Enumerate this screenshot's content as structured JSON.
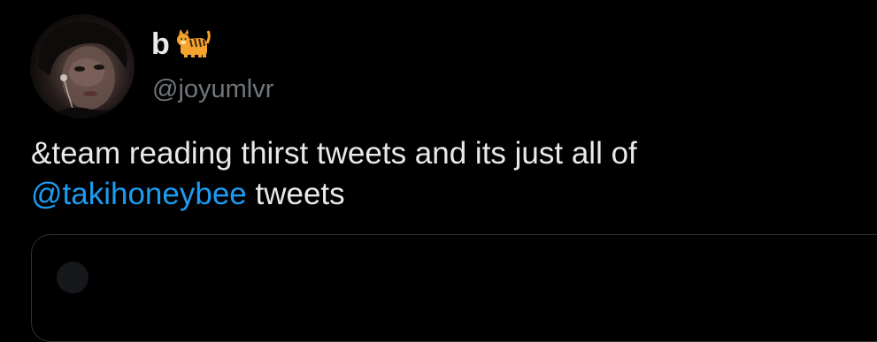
{
  "tweet": {
    "author": {
      "display_name": "b",
      "emoji": "tiger-emoji",
      "handle": "@joyumlvr"
    },
    "text_before": "&team reading thirst tweets and its just all of",
    "mention": "@takihoneybee",
    "text_after": " tweets"
  },
  "colors": {
    "background": "#000000",
    "text": "#e7e9ea",
    "secondary": "#71767b",
    "accent": "#1d9bf0",
    "border": "#2f3336"
  }
}
